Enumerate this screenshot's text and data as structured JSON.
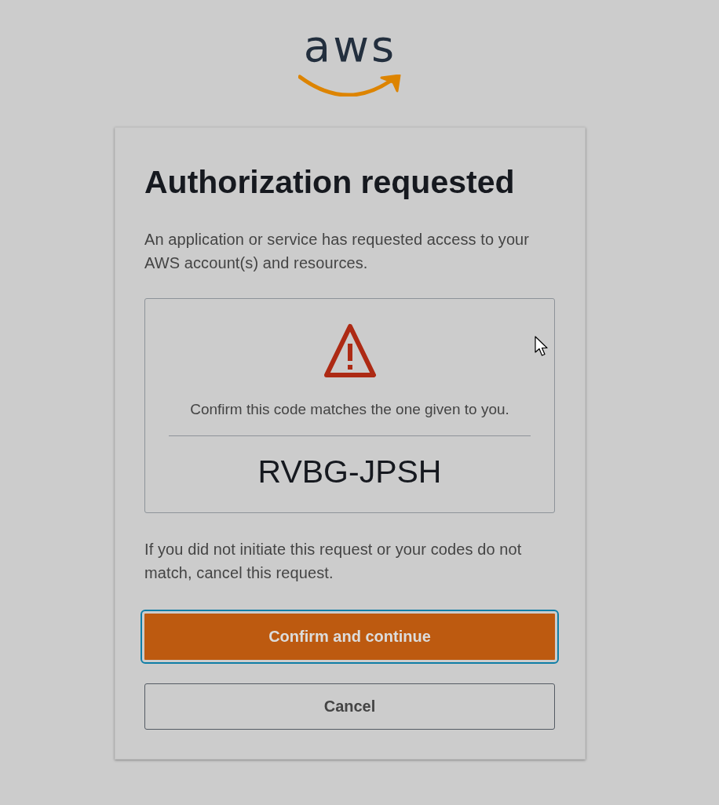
{
  "logo": {
    "text": "aws"
  },
  "dialog": {
    "title": "Authorization requested",
    "message": "An application or service has requested access to your AWS account(s) and resources.",
    "code_panel": {
      "instruction": "Confirm this code matches the one given to you.",
      "code": "RVBG-JPSH"
    },
    "notice": "If you did not initiate this request or your codes do not match, cancel this request.",
    "buttons": [
      {
        "kind": "primary",
        "label": "Confirm and continue",
        "focused": true
      },
      {
        "kind": "secondary",
        "label": "Cancel",
        "focused": false
      }
    ]
  }
}
